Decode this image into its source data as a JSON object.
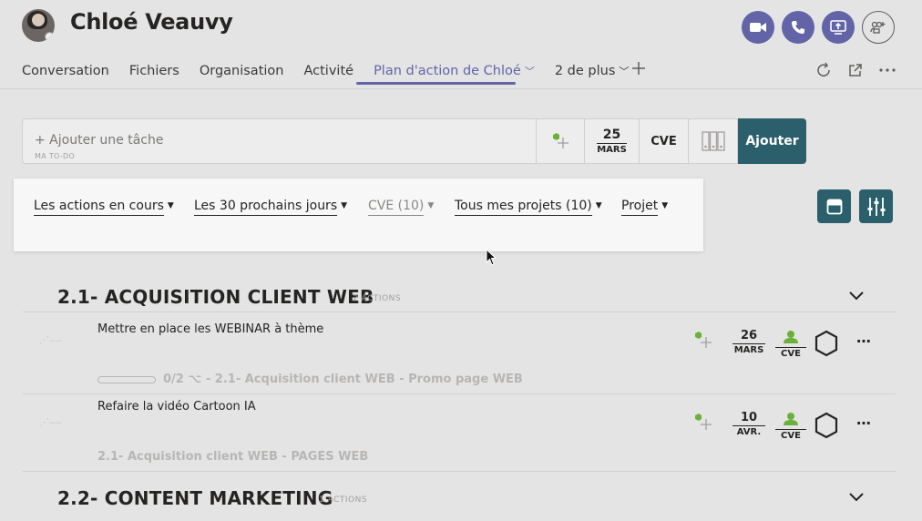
{
  "header": {
    "title": "Chloé Veauvy"
  },
  "tabs": [
    {
      "label": "Conversation"
    },
    {
      "label": "Fichiers"
    },
    {
      "label": "Organisation"
    },
    {
      "label": "Activité"
    },
    {
      "label": "Plan d'action de Chloé"
    },
    {
      "label": "2 de plus"
    }
  ],
  "composer": {
    "placeholder": "+ Ajouter une tâche",
    "subtitle": "MA TO-DO",
    "date_day": "25",
    "date_month": "MARS",
    "assignee": "CVE",
    "add_label": "Ajouter"
  },
  "filters": [
    {
      "label": "Les actions en cours"
    },
    {
      "label": "Les 30 prochains jours"
    },
    {
      "label": "CVE (10)"
    },
    {
      "label": "Tous mes projets (10)"
    },
    {
      "label": "Projet"
    }
  ],
  "sections": [
    {
      "title": "2.1- ACQUISITION CLIENT WEB",
      "count": "2 ACTIONS",
      "tasks": [
        {
          "title": "Mettre en place les WEBINAR à thème",
          "meta": "0/2 ⌥ - 2.1- Acquisition client WEB - Promo page WEB",
          "day": "26",
          "month": "MARS",
          "assignee": "CVE"
        },
        {
          "title": "Refaire la vidéo Cartoon IA",
          "meta": "2.1- Acquisition client WEB - PAGES WEB",
          "day": "10",
          "month": "AVR.",
          "assignee": "CVE"
        }
      ]
    },
    {
      "title": "2.2- CONTENT MARKETING",
      "count": "1 ACTIONS",
      "tasks": []
    }
  ],
  "colors": {
    "teams_purple": "#6264a7",
    "teal": "#2a5f6b",
    "green": "#6bb03a"
  },
  "icons": [
    "video-icon",
    "phone-icon",
    "screen-share-icon",
    "add-people-icon",
    "refresh-icon",
    "popout-icon",
    "more-icon",
    "plus-icon",
    "tag-icon",
    "kanban-icon",
    "card-view-icon",
    "settings-sliders-icon",
    "chevron-down-icon",
    "hexagon-icon",
    "person-icon",
    "drag-handle-icon"
  ]
}
